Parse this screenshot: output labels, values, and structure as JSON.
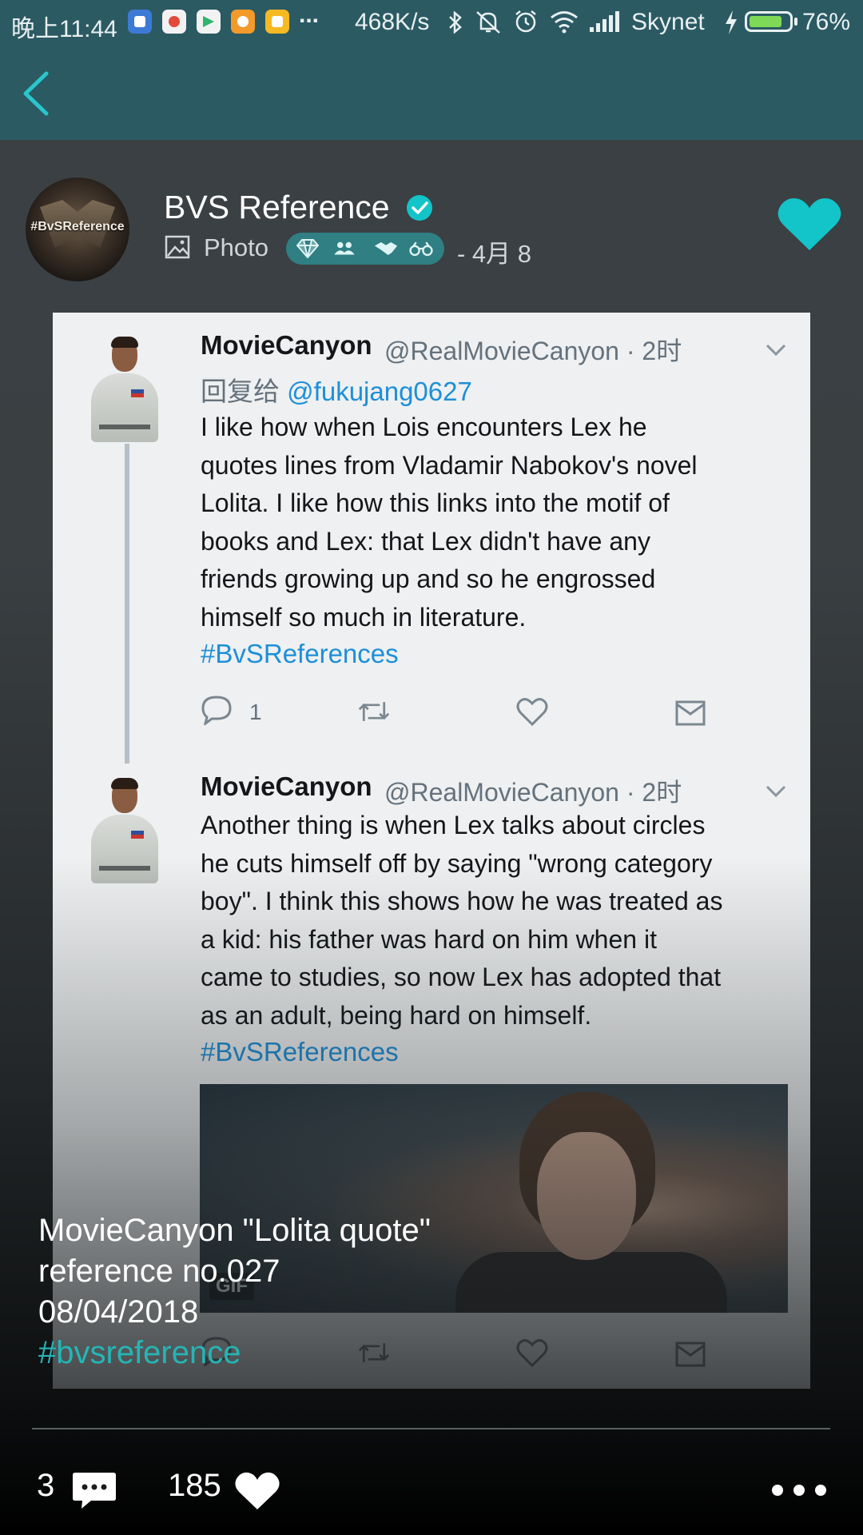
{
  "status_bar": {
    "time": "晚上11:44",
    "overflow": "...",
    "speed": "468K/s",
    "carrier": "Skynet",
    "battery": "76%",
    "notification_icons": [
      "app-icon-blue",
      "chrome-icon",
      "play-store-icon",
      "app-icon-orange",
      "app-icon-yellow"
    ],
    "colors": {
      "background": "#2b5a63",
      "battery_fill": "#7ed957"
    }
  },
  "app_bar": {
    "back_icon": "chevron-left-icon"
  },
  "post": {
    "author_name": "BVS Reference",
    "avatar_text": "#BvSReference",
    "post_type": "Photo",
    "date": "- 4月 8",
    "badge_icons": [
      "diamond-icon",
      "group-icon",
      "handshake-icon",
      "binoculars-icon"
    ],
    "liked": true,
    "accent_color": "#13c4c9"
  },
  "tweets": [
    {
      "name": "MovieCanyon",
      "handle": "@RealMovieCanyon · 2时",
      "reply_prefix": "回复给",
      "reply_mention": "@fukujang0627",
      "lines": [
        "I like how when Lois encounters Lex he",
        "quotes lines from Vladamir Nabokov's novel",
        "Lolita. I like how this links into the motif of",
        "books and Lex: that Lex didn't have any",
        "friends growing up and so he engrossed",
        "himself so much in literature."
      ],
      "hashtag": "#BvSReferences",
      "reply_count": "1"
    },
    {
      "name": "MovieCanyon",
      "handle": "@RealMovieCanyon · 2时",
      "lines": [
        "Another thing is when Lex talks about circles",
        "he cuts himself off by saying \"wrong category",
        "boy\". I think this shows how he was treated as",
        "a kid: his father was hard on him when it",
        "came to studies, so now Lex has adopted that",
        "as an adult, being hard on himself."
      ],
      "hashtag": "#BvSReferences",
      "media_label": "GIF"
    }
  ],
  "caption": {
    "lines": [
      "MovieCanyon \"Lolita quote\"",
      "reference no.027",
      "08/04/2018"
    ],
    "hashtag": "#bvsreference"
  },
  "footer": {
    "comment_count": "3",
    "like_count": "185"
  }
}
